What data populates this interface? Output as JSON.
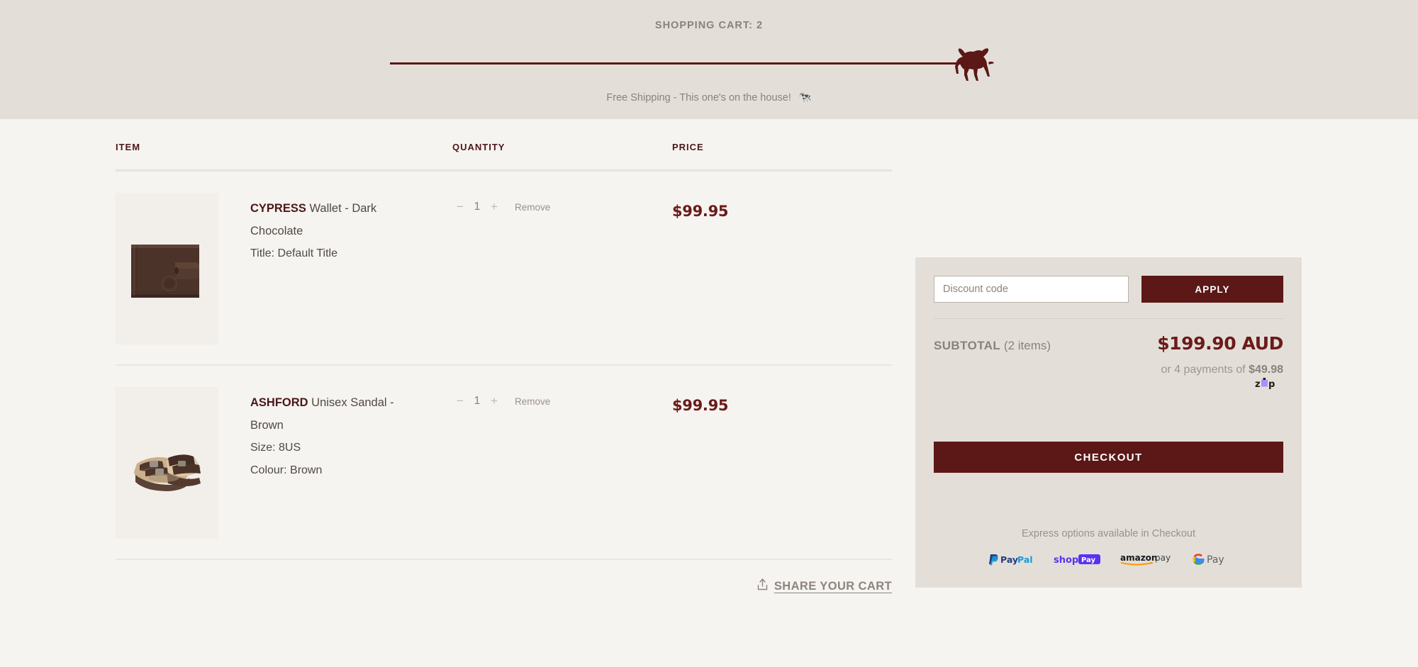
{
  "header": {
    "title": "SHOPPING CART: 2",
    "free_shipping_text": "Free Shipping - This one's on the house!",
    "cow_emoji": "🐄",
    "bull_icon": "bull-icon",
    "progress_percent": 100
  },
  "columns": {
    "item": "ITEM",
    "quantity": "QUANTITY",
    "price": "PRICE"
  },
  "items": [
    {
      "brand": "CYPRESS",
      "name": " Wallet - Dark Chocolate",
      "options": [
        "Title: Default Title"
      ],
      "quantity": "1",
      "decrease_label": "−",
      "increase_label": "+",
      "remove_label": "Remove",
      "price": "$99.95",
      "image_name": "cypress-wallet-dark-chocolate-image"
    },
    {
      "brand": "ASHFORD",
      "name": " Unisex Sandal - Brown",
      "options": [
        "Size: 8US",
        "Colour: Brown"
      ],
      "quantity": "1",
      "decrease_label": "−",
      "increase_label": "+",
      "remove_label": "Remove",
      "price": "$99.95",
      "image_name": "ashford-unisex-sandal-brown-image"
    }
  ],
  "share": {
    "label": "SHARE YOUR CART",
    "icon": "share-upload-icon"
  },
  "summary": {
    "discount_placeholder": "Discount code",
    "discount_value": "",
    "apply_label": "APPLY",
    "subtotal_label": "SUBTOTAL",
    "subtotal_items": "(2 items)",
    "subtotal_value": "$199.90 AUD",
    "installment_prefix": "or 4 payments of ",
    "installment_amount": "$49.98",
    "installment_provider": "zip",
    "checkout_label": "CHECKOUT",
    "express_note": "Express options available in Checkout",
    "payment_methods": [
      {
        "name": "paypal-logo",
        "label": "PayPal"
      },
      {
        "name": "shop-pay-logo",
        "label": "shop Pay"
      },
      {
        "name": "amazon-pay-logo",
        "label": "amazon pay"
      },
      {
        "name": "google-pay-logo",
        "label": "G Pay"
      }
    ]
  },
  "colors": {
    "header_bg": "#e3dfd8",
    "page_bg": "#f6f4f0",
    "brand_dark_red": "#5c1717",
    "price_red": "#6b1a1a",
    "muted_text": "#8b817c"
  }
}
